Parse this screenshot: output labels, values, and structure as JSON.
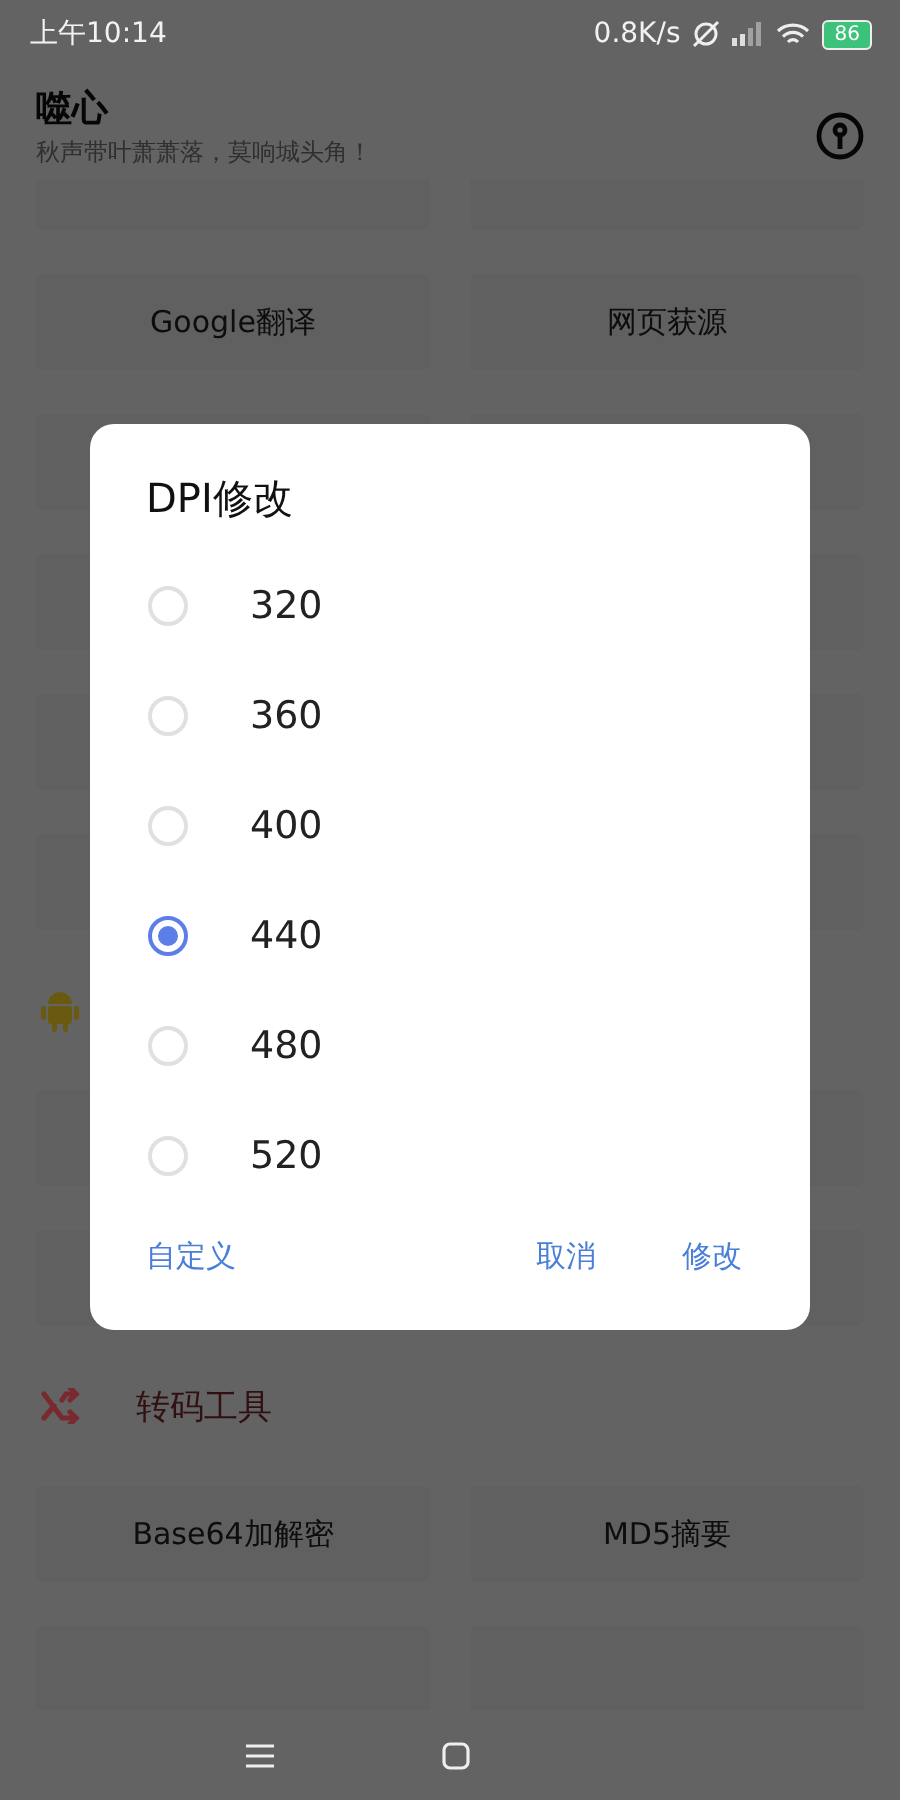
{
  "status_bar": {
    "time": "上午10:14",
    "speed": "0.8K/s",
    "battery": "86"
  },
  "header": {
    "title": "噬心",
    "subtitle": "秋声带叶萧萧落，莫响城头角！"
  },
  "content": [
    {
      "kind": "cards"
    },
    {
      "kind": "cards",
      "labels": [
        "Google翻译",
        "网页获源"
      ]
    },
    {
      "kind": "cards"
    },
    {
      "kind": "cards"
    },
    {
      "kind": "cards"
    },
    {
      "kind": "cards"
    },
    {
      "kind": "android-heading",
      "color": "#6a5a10"
    },
    {
      "kind": "cards"
    },
    {
      "kind": "cards"
    },
    {
      "kind": "shuffle-heading",
      "color": "#7a2a2e",
      "title": "转码工具"
    },
    {
      "kind": "cards",
      "labels": [
        "Base64加解密",
        "MD5摘要"
      ]
    },
    {
      "kind": "cards"
    }
  ],
  "dialog": {
    "title": "DPI修改",
    "options": [
      {
        "label": "320",
        "selected": false
      },
      {
        "label": "360",
        "selected": false
      },
      {
        "label": "400",
        "selected": false
      },
      {
        "label": "440",
        "selected": true
      },
      {
        "label": "480",
        "selected": false
      },
      {
        "label": "520",
        "selected": false
      }
    ],
    "left_button": "自定义",
    "right_buttons": [
      "取消",
      "修改"
    ]
  }
}
